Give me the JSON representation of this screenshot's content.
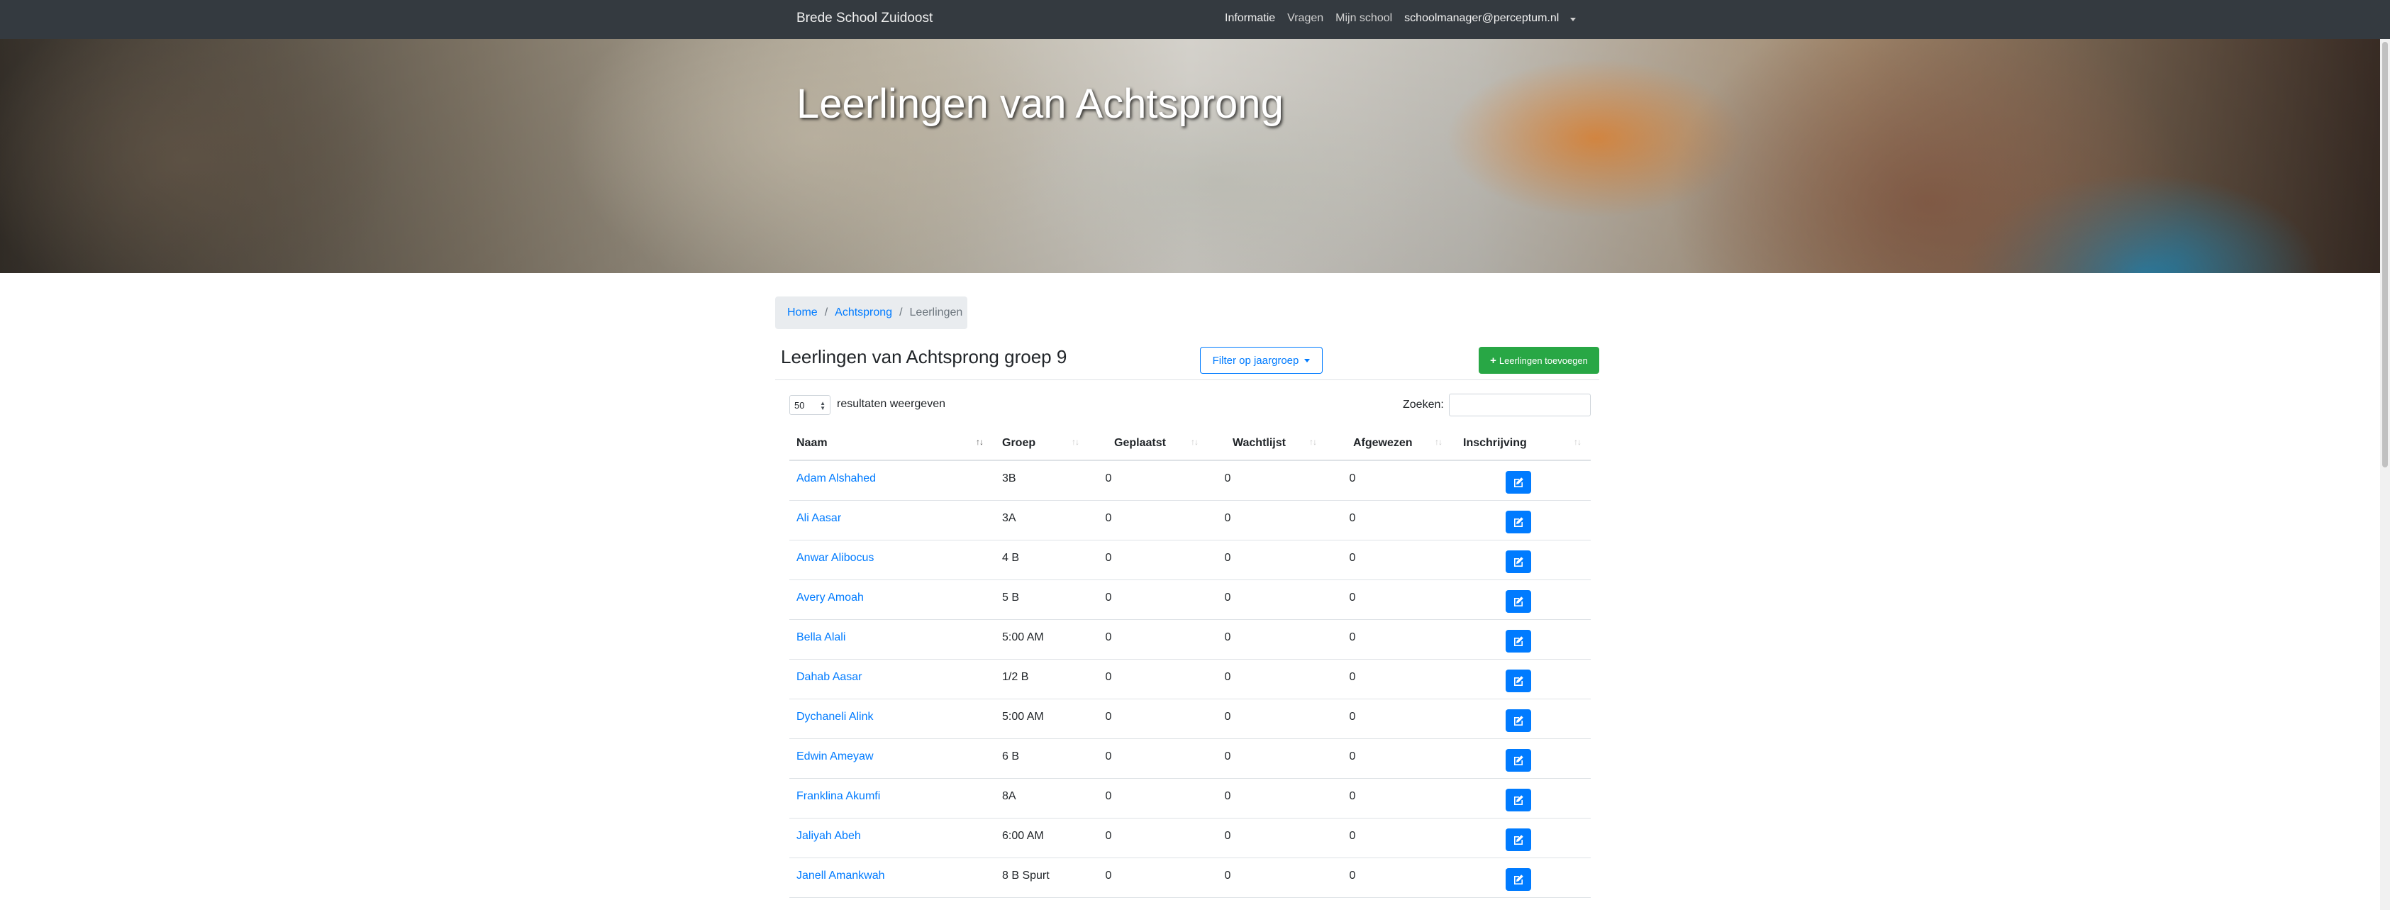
{
  "navbar": {
    "brand": "Brede School Zuidoost",
    "links": [
      "Informatie",
      "Vragen",
      "Mijn school",
      "schoolmanager@perceptum.nl"
    ]
  },
  "hero": {
    "title": "Leerlingen van Achtsprong"
  },
  "breadcrumb": {
    "home": "Home",
    "school": "Achtsprong",
    "current": "Leerlingen",
    "separator": "/"
  },
  "heading": "Leerlingen van Achtsprong groep 9",
  "filter_button": "Filter op jaargroep",
  "add_button": "Leerlingen toevoegen",
  "controls": {
    "page_length": "50",
    "page_length_label": "resultaten weergeven",
    "search_label": "Zoeken:",
    "search_value": ""
  },
  "table": {
    "columns": [
      "Naam",
      "Groep",
      "Geplaatst",
      "Wachtlijst",
      "Afgewezen",
      "Inschrijving"
    ],
    "sorted_column": "Naam",
    "rows": [
      {
        "naam": "Adam Alshahed",
        "groep": "3B",
        "geplaatst": "0",
        "wachtlijst": "0",
        "afgewezen": "0"
      },
      {
        "naam": "Ali Aasar",
        "groep": "3A",
        "geplaatst": "0",
        "wachtlijst": "0",
        "afgewezen": "0"
      },
      {
        "naam": "Anwar Alibocus",
        "groep": "4 B",
        "geplaatst": "0",
        "wachtlijst": "0",
        "afgewezen": "0"
      },
      {
        "naam": "Avery Amoah",
        "groep": "5 B",
        "geplaatst": "0",
        "wachtlijst": "0",
        "afgewezen": "0"
      },
      {
        "naam": "Bella Alali",
        "groep": "5:00 AM",
        "geplaatst": "0",
        "wachtlijst": "0",
        "afgewezen": "0"
      },
      {
        "naam": "Dahab Aasar",
        "groep": "1/2 B",
        "geplaatst": "0",
        "wachtlijst": "0",
        "afgewezen": "0"
      },
      {
        "naam": "Dychaneli Alink",
        "groep": "5:00 AM",
        "geplaatst": "0",
        "wachtlijst": "0",
        "afgewezen": "0"
      },
      {
        "naam": "Edwin Ameyaw",
        "groep": "6 B",
        "geplaatst": "0",
        "wachtlijst": "0",
        "afgewezen": "0"
      },
      {
        "naam": "Franklina Akumfi",
        "groep": "8A",
        "geplaatst": "0",
        "wachtlijst": "0",
        "afgewezen": "0"
      },
      {
        "naam": "Jaliyah Abeh",
        "groep": "6:00 AM",
        "geplaatst": "0",
        "wachtlijst": "0",
        "afgewezen": "0"
      },
      {
        "naam": "Janell Amankwah",
        "groep": "8 B Spurt",
        "geplaatst": "0",
        "wachtlijst": "0",
        "afgewezen": "0"
      }
    ]
  },
  "colors": {
    "link": "#007bff",
    "success": "#28a745",
    "navbar": "#343a40"
  }
}
